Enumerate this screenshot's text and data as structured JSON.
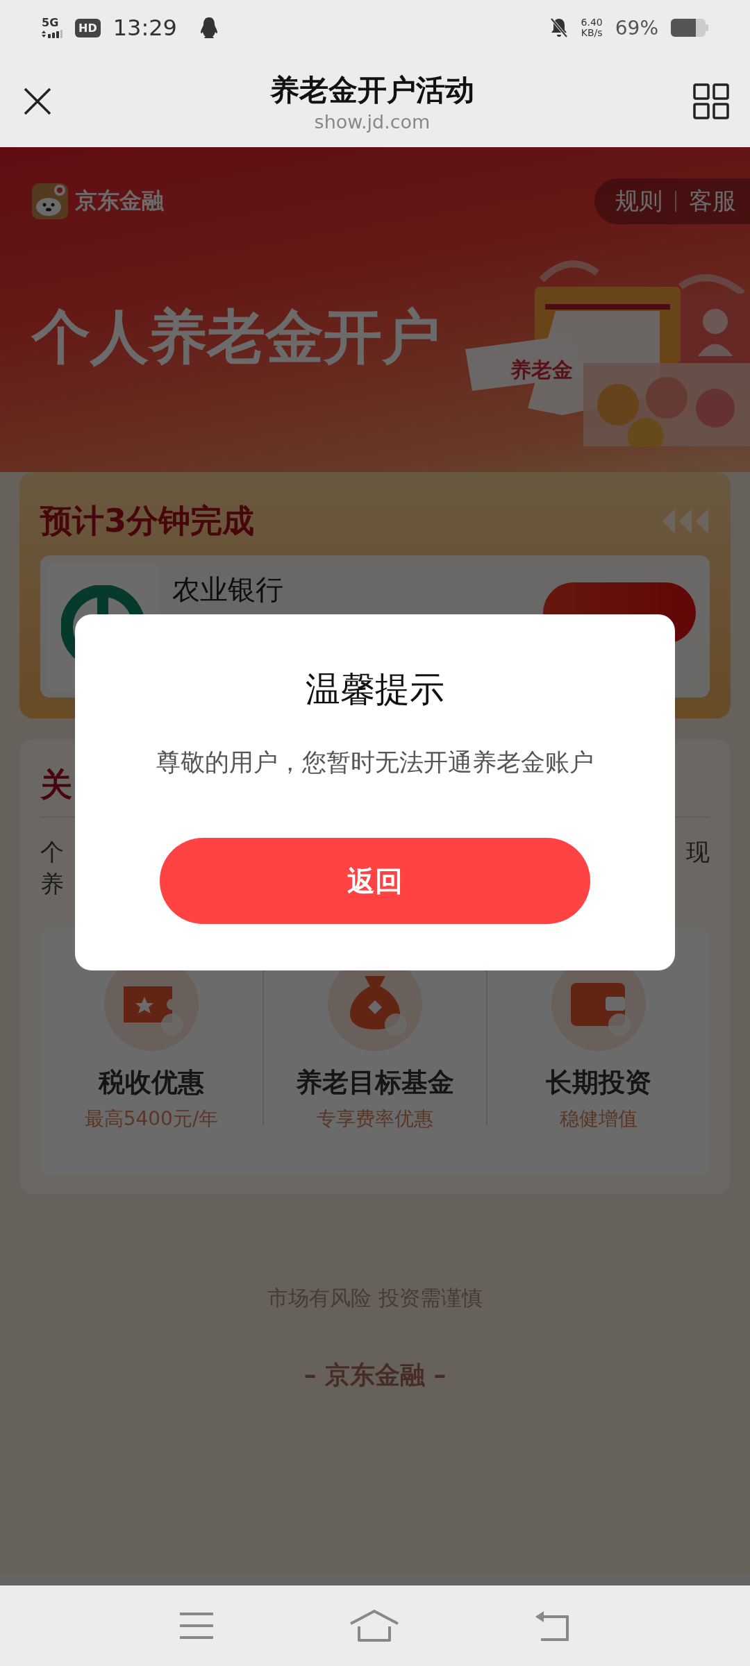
{
  "status_bar": {
    "network": "5G",
    "hd_badge": "HD",
    "time": "13:29",
    "speed_value": "6.40",
    "speed_unit": "KB/s",
    "battery": "69%"
  },
  "header": {
    "title": "养老金开户活动",
    "url": "show.jd.com"
  },
  "banner": {
    "brand": "京东金融",
    "links": [
      {
        "label": "规则"
      },
      {
        "label": "客服"
      }
    ],
    "title": "个人养老金开户",
    "illustration_label": "养老金"
  },
  "account_card": {
    "title": "预计3分钟完成",
    "bank_name": "农业银行"
  },
  "about_card": {
    "title": "关",
    "paragraph_lines": [
      {
        "left": "个",
        "right": "现"
      },
      {
        "left": "养"
      }
    ],
    "features": [
      {
        "kind": "ticket",
        "title": "税收优惠",
        "subtitle": "最高5400元/年"
      },
      {
        "kind": "moneybag",
        "title": "养老目标基金",
        "subtitle": "专享费率优惠"
      },
      {
        "kind": "wallet",
        "title": "长期投资",
        "subtitle": "稳健增值"
      }
    ]
  },
  "footer": {
    "disclaimer": "市场有风险 投资需谨慎",
    "brand": "– 京东金融 –"
  },
  "dialog": {
    "title": "温馨提示",
    "message": "尊敬的用户，您暂时无法开通养老金账户",
    "button": "返回"
  }
}
